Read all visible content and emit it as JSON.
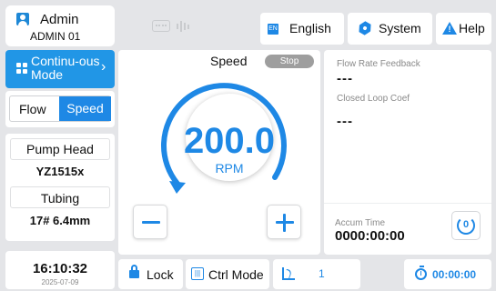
{
  "user": {
    "name": "Admin",
    "role": "ADMIN 01"
  },
  "mode": {
    "label": "Continu-ous Mode"
  },
  "control_toggle": {
    "flow_label": "Flow",
    "speed_label": "Speed",
    "selected": "Speed"
  },
  "pump": {
    "head_label": "Pump Head",
    "head_value": "YZ1515x",
    "tubing_label": "Tubing",
    "tubing_value": "17# 6.4mm"
  },
  "clock": {
    "time": "16:10:32",
    "date": "2025-07-09"
  },
  "topbar": {
    "language": "English",
    "language_code": "EN",
    "system": "System",
    "help": "Help"
  },
  "speed_panel": {
    "title": "Speed",
    "status": "Stop",
    "value": "200.0",
    "unit": "RPM"
  },
  "info": {
    "flow_rate_label": "Flow Rate Feedback",
    "flow_rate_value": "---",
    "closed_loop_label": "Closed Loop Coef",
    "closed_loop_value": "---",
    "accum_label": "Accum Time",
    "accum_value": "0000:00:00",
    "reset_icon_text": "0"
  },
  "bottombar": {
    "lock": "Lock",
    "ctrl_mode": "Ctrl Mode",
    "curve_value": "1",
    "timer": "00:00:00"
  },
  "colors": {
    "accent": "#1e88e5",
    "background": "#e4e5e8",
    "panel": "#ffffff",
    "status_stop": "#9e9e9e"
  },
  "icons": [
    "user-icon",
    "grid-icon",
    "chevron-right-icon",
    "keyboard-icon",
    "waveform-icon",
    "language-icon",
    "gear-icon",
    "warning-help-icon",
    "minus-icon",
    "plus-icon",
    "reset-icon",
    "lock-icon",
    "control-sliders-icon",
    "curve-icon",
    "timer-icon"
  ]
}
